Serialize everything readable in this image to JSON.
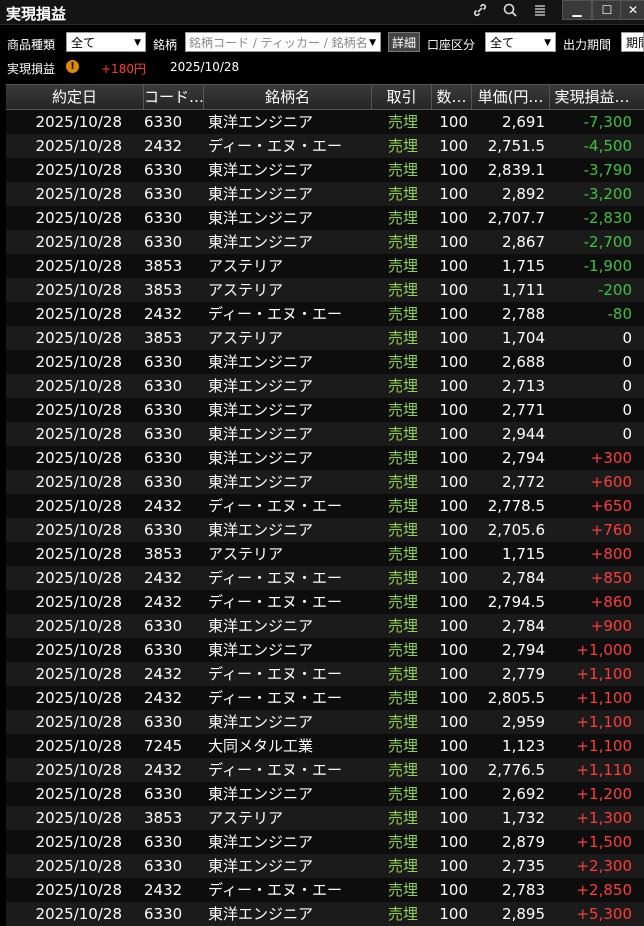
{
  "window": {
    "title": "実現損益",
    "icons": [
      "link-icon",
      "search-icon",
      "menu-icon"
    ],
    "controls": [
      "▁",
      "☐",
      "✕"
    ]
  },
  "filters": {
    "product_type_label": "商品種類",
    "product_type_value": "全て",
    "symbol_label": "銘柄",
    "symbol_placeholder": "銘柄コード / ティッカー / 銘柄名",
    "detail_button": "詳細",
    "account_label": "口座区分",
    "account_value": "全て",
    "period_label": "出力期間",
    "period_button": "期間"
  },
  "summary": {
    "label": "実現損益",
    "total": "+180円",
    "date": "2025/10/28"
  },
  "table": {
    "headers": [
      "約定日",
      "コード…",
      "銘柄名",
      "取引",
      "数…",
      "単価(円…",
      "実現損益…"
    ],
    "rows": [
      {
        "date": "2025/10/28",
        "code": "6330",
        "name": "東洋エンジニア",
        "trade": "売埋",
        "qty": "100",
        "price": "2,691",
        "pl": "-7,300",
        "sign": "neg"
      },
      {
        "date": "2025/10/28",
        "code": "2432",
        "name": "ディー・エヌ・エー",
        "trade": "売埋",
        "qty": "100",
        "price": "2,751.5",
        "pl": "-4,500",
        "sign": "neg"
      },
      {
        "date": "2025/10/28",
        "code": "6330",
        "name": "東洋エンジニア",
        "trade": "売埋",
        "qty": "100",
        "price": "2,839.1",
        "pl": "-3,790",
        "sign": "neg"
      },
      {
        "date": "2025/10/28",
        "code": "6330",
        "name": "東洋エンジニア",
        "trade": "売埋",
        "qty": "100",
        "price": "2,892",
        "pl": "-3,200",
        "sign": "neg"
      },
      {
        "date": "2025/10/28",
        "code": "6330",
        "name": "東洋エンジニア",
        "trade": "売埋",
        "qty": "100",
        "price": "2,707.7",
        "pl": "-2,830",
        "sign": "neg"
      },
      {
        "date": "2025/10/28",
        "code": "6330",
        "name": "東洋エンジニア",
        "trade": "売埋",
        "qty": "100",
        "price": "2,867",
        "pl": "-2,700",
        "sign": "neg"
      },
      {
        "date": "2025/10/28",
        "code": "3853",
        "name": "アステリア",
        "trade": "売埋",
        "qty": "100",
        "price": "1,715",
        "pl": "-1,900",
        "sign": "neg"
      },
      {
        "date": "2025/10/28",
        "code": "3853",
        "name": "アステリア",
        "trade": "売埋",
        "qty": "100",
        "price": "1,711",
        "pl": "-200",
        "sign": "neg"
      },
      {
        "date": "2025/10/28",
        "code": "2432",
        "name": "ディー・エヌ・エー",
        "trade": "売埋",
        "qty": "100",
        "price": "2,788",
        "pl": "-80",
        "sign": "neg"
      },
      {
        "date": "2025/10/28",
        "code": "3853",
        "name": "アステリア",
        "trade": "売埋",
        "qty": "100",
        "price": "1,704",
        "pl": "0",
        "sign": "zero"
      },
      {
        "date": "2025/10/28",
        "code": "6330",
        "name": "東洋エンジニア",
        "trade": "売埋",
        "qty": "100",
        "price": "2,688",
        "pl": "0",
        "sign": "zero"
      },
      {
        "date": "2025/10/28",
        "code": "6330",
        "name": "東洋エンジニア",
        "trade": "売埋",
        "qty": "100",
        "price": "2,713",
        "pl": "0",
        "sign": "zero"
      },
      {
        "date": "2025/10/28",
        "code": "6330",
        "name": "東洋エンジニア",
        "trade": "売埋",
        "qty": "100",
        "price": "2,771",
        "pl": "0",
        "sign": "zero"
      },
      {
        "date": "2025/10/28",
        "code": "6330",
        "name": "東洋エンジニア",
        "trade": "売埋",
        "qty": "100",
        "price": "2,944",
        "pl": "0",
        "sign": "zero"
      },
      {
        "date": "2025/10/28",
        "code": "6330",
        "name": "東洋エンジニア",
        "trade": "売埋",
        "qty": "100",
        "price": "2,794",
        "pl": "+300",
        "sign": "pos"
      },
      {
        "date": "2025/10/28",
        "code": "6330",
        "name": "東洋エンジニア",
        "trade": "売埋",
        "qty": "100",
        "price": "2,772",
        "pl": "+600",
        "sign": "pos"
      },
      {
        "date": "2025/10/28",
        "code": "2432",
        "name": "ディー・エヌ・エー",
        "trade": "売埋",
        "qty": "100",
        "price": "2,778.5",
        "pl": "+650",
        "sign": "pos"
      },
      {
        "date": "2025/10/28",
        "code": "6330",
        "name": "東洋エンジニア",
        "trade": "売埋",
        "qty": "100",
        "price": "2,705.6",
        "pl": "+760",
        "sign": "pos"
      },
      {
        "date": "2025/10/28",
        "code": "3853",
        "name": "アステリア",
        "trade": "売埋",
        "qty": "100",
        "price": "1,715",
        "pl": "+800",
        "sign": "pos"
      },
      {
        "date": "2025/10/28",
        "code": "2432",
        "name": "ディー・エヌ・エー",
        "trade": "売埋",
        "qty": "100",
        "price": "2,784",
        "pl": "+850",
        "sign": "pos"
      },
      {
        "date": "2025/10/28",
        "code": "2432",
        "name": "ディー・エヌ・エー",
        "trade": "売埋",
        "qty": "100",
        "price": "2,794.5",
        "pl": "+860",
        "sign": "pos"
      },
      {
        "date": "2025/10/28",
        "code": "6330",
        "name": "東洋エンジニア",
        "trade": "売埋",
        "qty": "100",
        "price": "2,784",
        "pl": "+900",
        "sign": "pos"
      },
      {
        "date": "2025/10/28",
        "code": "6330",
        "name": "東洋エンジニア",
        "trade": "売埋",
        "qty": "100",
        "price": "2,794",
        "pl": "+1,000",
        "sign": "pos"
      },
      {
        "date": "2025/10/28",
        "code": "2432",
        "name": "ディー・エヌ・エー",
        "trade": "売埋",
        "qty": "100",
        "price": "2,779",
        "pl": "+1,100",
        "sign": "pos"
      },
      {
        "date": "2025/10/28",
        "code": "2432",
        "name": "ディー・エヌ・エー",
        "trade": "売埋",
        "qty": "100",
        "price": "2,805.5",
        "pl": "+1,100",
        "sign": "pos"
      },
      {
        "date": "2025/10/28",
        "code": "6330",
        "name": "東洋エンジニア",
        "trade": "売埋",
        "qty": "100",
        "price": "2,959",
        "pl": "+1,100",
        "sign": "pos"
      },
      {
        "date": "2025/10/28",
        "code": "7245",
        "name": "大同メタル工業",
        "trade": "売埋",
        "qty": "100",
        "price": "1,123",
        "pl": "+1,100",
        "sign": "pos"
      },
      {
        "date": "2025/10/28",
        "code": "2432",
        "name": "ディー・エヌ・エー",
        "trade": "売埋",
        "qty": "100",
        "price": "2,776.5",
        "pl": "+1,110",
        "sign": "pos"
      },
      {
        "date": "2025/10/28",
        "code": "6330",
        "name": "東洋エンジニア",
        "trade": "売埋",
        "qty": "100",
        "price": "2,692",
        "pl": "+1,200",
        "sign": "pos"
      },
      {
        "date": "2025/10/28",
        "code": "3853",
        "name": "アステリア",
        "trade": "売埋",
        "qty": "100",
        "price": "1,732",
        "pl": "+1,300",
        "sign": "pos"
      },
      {
        "date": "2025/10/28",
        "code": "6330",
        "name": "東洋エンジニア",
        "trade": "売埋",
        "qty": "100",
        "price": "2,879",
        "pl": "+1,500",
        "sign": "pos"
      },
      {
        "date": "2025/10/28",
        "code": "6330",
        "name": "東洋エンジニア",
        "trade": "売埋",
        "qty": "100",
        "price": "2,735",
        "pl": "+2,300",
        "sign": "pos"
      },
      {
        "date": "2025/10/28",
        "code": "2432",
        "name": "ディー・エヌ・エー",
        "trade": "売埋",
        "qty": "100",
        "price": "2,783",
        "pl": "+2,850",
        "sign": "pos"
      },
      {
        "date": "2025/10/28",
        "code": "6330",
        "name": "東洋エンジニア",
        "trade": "売埋",
        "qty": "100",
        "price": "2,895",
        "pl": "+5,300",
        "sign": "pos"
      }
    ]
  },
  "colors": {
    "loss": "#3ec13e",
    "profit": "#ff3b3b",
    "trade": "#8fd14f",
    "summary_total": "#ff3b3b",
    "warning": "#e08a00"
  }
}
